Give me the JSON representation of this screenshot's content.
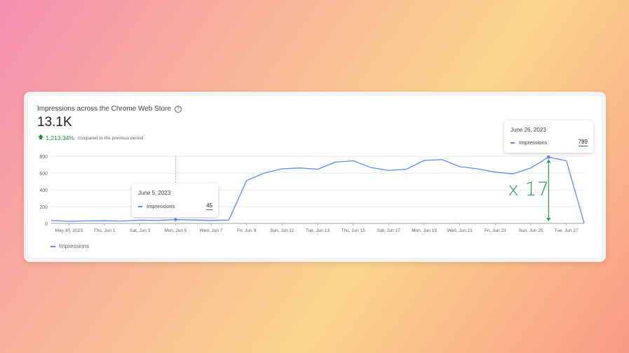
{
  "card": {
    "title": "Impressions across the Chrome Web Store",
    "total": "13.1K",
    "delta": "1,213.34%",
    "delta_note": "compared to the previous period",
    "legend_label": "Impressions"
  },
  "tooltips": [
    {
      "date": "June 5, 2023",
      "label": "Impressions",
      "value": "45"
    },
    {
      "date": "June 26, 2023",
      "label": "Impressions",
      "value": "789"
    }
  ],
  "annotation": {
    "multiplier": "x 17",
    "color": "#22a052"
  },
  "colors": {
    "series": "#5b8def",
    "positive": "#1e8e3e"
  },
  "chart_data": {
    "type": "line",
    "title": "Impressions across the Chrome Web Store",
    "xlabel": "",
    "ylabel": "",
    "ylim": [
      0,
      800
    ],
    "yticks": [
      0,
      200,
      400,
      600,
      800
    ],
    "x_tick_labels": [
      "May 30, 2023",
      "Thu, Jun 1",
      "Sat, Jun 3",
      "Mon, Jun 5",
      "Wed, Jun 7",
      "Fri, Jun 9",
      "Sun, Jun 11",
      "Tue, Jun 13",
      "Thu, Jun 15",
      "Sat, Jun 17",
      "Mon, Jun 19",
      "Wed, Jun 21",
      "Fri, Jun 23",
      "Sun, Jun 25",
      "Tue, Jun 27"
    ],
    "grid": true,
    "legend": "bottom-left",
    "series": [
      {
        "name": "Impressions",
        "x": [
          "2023-05-29",
          "2023-05-30",
          "2023-05-31",
          "2023-06-01",
          "2023-06-02",
          "2023-06-03",
          "2023-06-04",
          "2023-06-05",
          "2023-06-06",
          "2023-06-07",
          "2023-06-08",
          "2023-06-09",
          "2023-06-10",
          "2023-06-11",
          "2023-06-12",
          "2023-06-13",
          "2023-06-14",
          "2023-06-15",
          "2023-06-16",
          "2023-06-17",
          "2023-06-18",
          "2023-06-19",
          "2023-06-20",
          "2023-06-21",
          "2023-06-22",
          "2023-06-23",
          "2023-06-24",
          "2023-06-25",
          "2023-06-26",
          "2023-06-27",
          "2023-06-28"
        ],
        "values": [
          35,
          25,
          30,
          32,
          28,
          38,
          35,
          45,
          40,
          35,
          40,
          510,
          600,
          650,
          660,
          645,
          730,
          745,
          665,
          630,
          645,
          750,
          760,
          675,
          650,
          610,
          590,
          660,
          789,
          745,
          5
        ]
      }
    ]
  }
}
